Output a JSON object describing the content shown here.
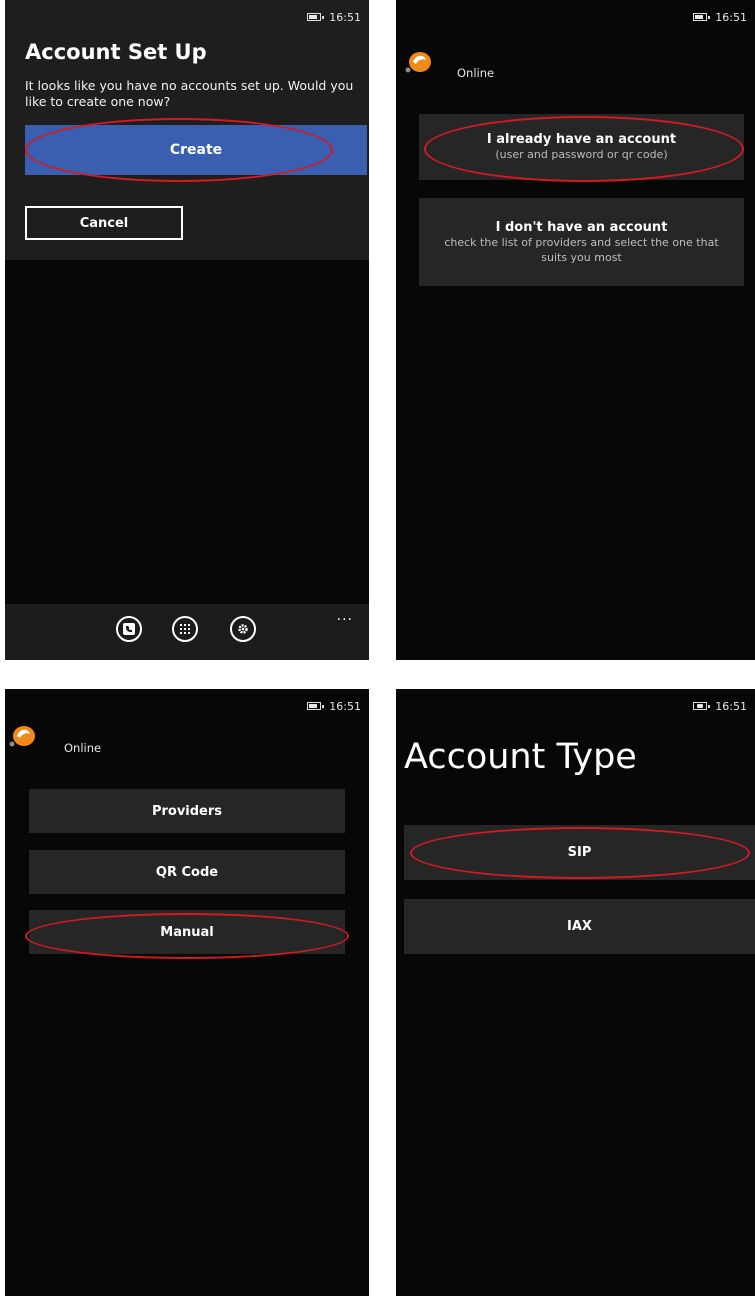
{
  "status": {
    "time": "16:51"
  },
  "screen1": {
    "title": "Account Set Up",
    "message": "It looks like you have no accounts set up. Would you like to create one now?",
    "create_label": "Create",
    "cancel_label": "Cancel",
    "appbar": {
      "icons": [
        "contacts-icon",
        "dialpad-icon",
        "settings-icon"
      ],
      "more_label": "..."
    }
  },
  "screen2": {
    "status_text": "Online",
    "options": [
      {
        "title": "I already have an account",
        "subtitle": "(user and password or qr code)"
      },
      {
        "title": "I don't have an account",
        "subtitle": "check the list of providers and select the one that suits you most"
      }
    ]
  },
  "screen3": {
    "status_text": "Online",
    "options": [
      "Providers",
      "QR Code",
      "Manual"
    ]
  },
  "screen4": {
    "title": "Account Type",
    "options": [
      "SIP",
      "IAX"
    ]
  },
  "colors": {
    "accent": "#3a5fb0",
    "highlight_ring": "#d21a24",
    "logo_orange": "#f08a1c",
    "panel": "#262626"
  }
}
